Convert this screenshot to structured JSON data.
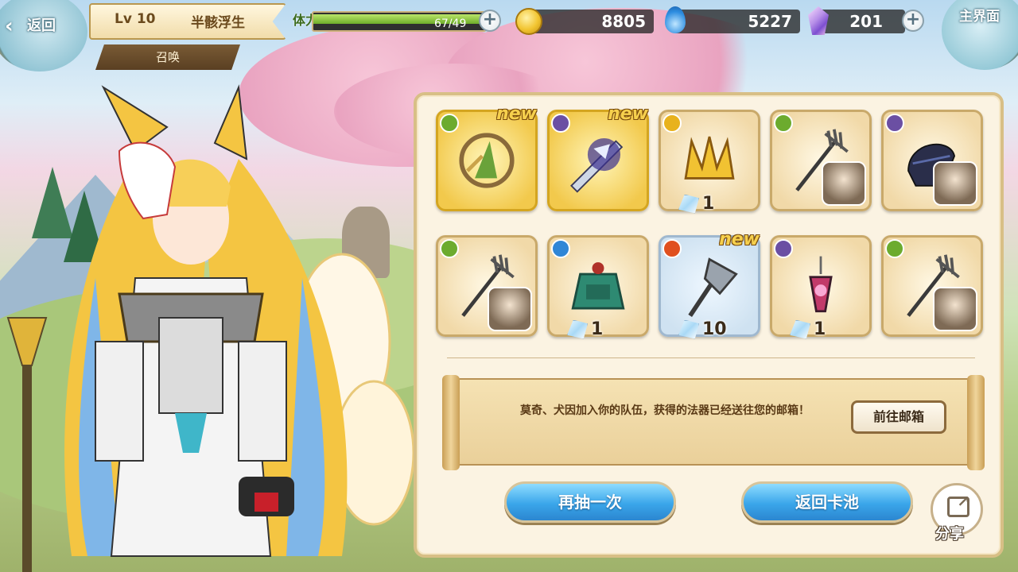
{
  "header": {
    "back_label": "返回",
    "level": "Lv 10",
    "player_name": "半骸浮生",
    "section_tab": "召唤",
    "stamina_label": "体力",
    "stamina_text": "67/49",
    "stamina_fraction": 1.0,
    "gold": "8805",
    "water": "5227",
    "crystal": "201",
    "home_label": "主界面"
  },
  "results": {
    "items": [
      {
        "name": "bamboo-ring",
        "element": "wind",
        "rarity": "gold",
        "is_new": true,
        "new_label": "new",
        "count": "",
        "has_portrait": false
      },
      {
        "name": "spirit-sword",
        "element": "shadow",
        "rarity": "gold",
        "is_new": true,
        "new_label": "new",
        "count": "",
        "has_portrait": false
      },
      {
        "name": "golden-crown",
        "element": "light",
        "rarity": "normal",
        "is_new": false,
        "new_label": "",
        "count": "1",
        "has_portrait": false
      },
      {
        "name": "rake-staff",
        "element": "wind",
        "rarity": "normal",
        "is_new": false,
        "new_label": "",
        "count": "",
        "has_portrait": true
      },
      {
        "name": "dark-mask",
        "element": "shadow",
        "rarity": "normal",
        "is_new": false,
        "new_label": "",
        "count": "",
        "has_portrait": true
      },
      {
        "name": "rake-staff",
        "element": "wind",
        "rarity": "normal",
        "is_new": false,
        "new_label": "",
        "count": "",
        "has_portrait": true
      },
      {
        "name": "jade-bell",
        "element": "water",
        "rarity": "normal",
        "is_new": false,
        "new_label": "",
        "count": "1",
        "has_portrait": false
      },
      {
        "name": "battle-axe",
        "element": "fire",
        "rarity": "blue",
        "is_new": true,
        "new_label": "new",
        "count": "10",
        "has_portrait": false
      },
      {
        "name": "pendulum-charm",
        "element": "shadow",
        "rarity": "normal",
        "is_new": false,
        "new_label": "",
        "count": "1",
        "has_portrait": false
      },
      {
        "name": "rake-staff",
        "element": "wind",
        "rarity": "normal",
        "is_new": false,
        "new_label": "",
        "count": "",
        "has_portrait": true
      }
    ],
    "notice_text": "莫奇、犬因加入你的队伍，获得的法器已经送往您的邮箱！",
    "mail_button": "前往邮箱",
    "draw_again": "再抽一次",
    "back_to_pool": "返回卡池",
    "share_label": "分享"
  },
  "colors": {
    "wind": "#6cab2e",
    "shadow": "#6b4fa3",
    "light": "#e8b21d",
    "water": "#2f86d6",
    "fire": "#e0501f"
  }
}
